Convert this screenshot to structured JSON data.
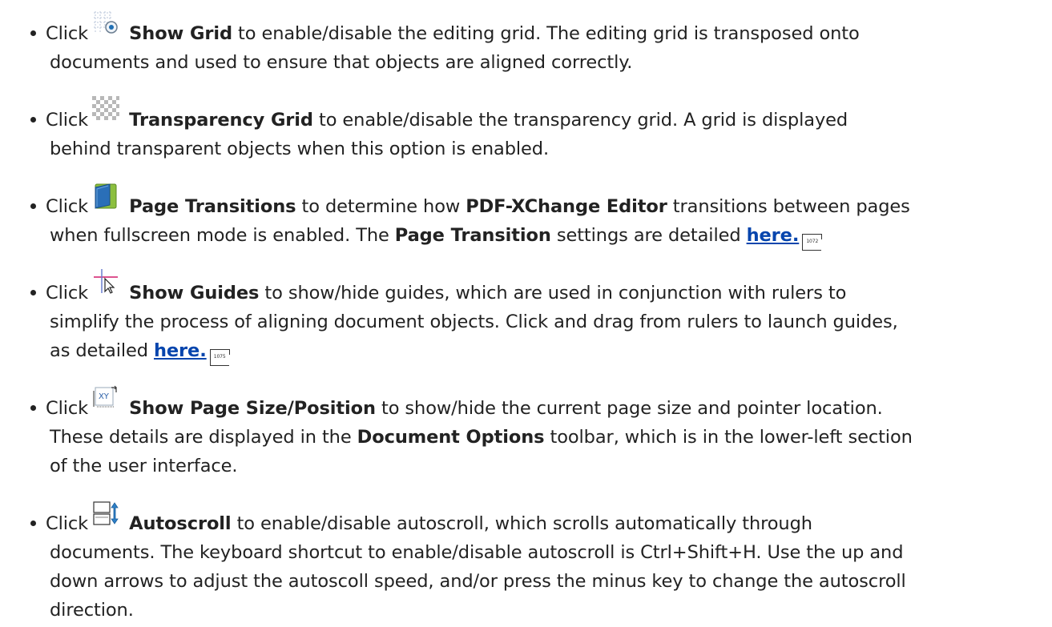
{
  "items": [
    {
      "lines": [
        [
          "Click ",
          "",
          " to enable/disable the editing grid. The editing grid is transposed onto"
        ],
        "documents and used to ensure that objects are aligned correctly."
      ],
      "bold": "Show Grid",
      "icon": "show-grid-icon"
    },
    {
      "lines": [
        [
          "Click ",
          "",
          " to enable/disable the transparency grid. A grid is displayed"
        ],
        "behind transparent objects when this option is enabled."
      ],
      "bold": "Transparency Grid",
      "icon": "transparency-grid-icon"
    },
    {
      "bold": "Page Transitions",
      "icon": "page-transitions-icon",
      "l1_pre": "Click ",
      "l1_mid": " to determine how ",
      "l1_bold2": "PDF-XChange Editor",
      "l1_post": " transitions between pages",
      "l2_pre": "when fullscreen mode is enabled. The ",
      "l2_bold": "Page Transition",
      "l2_mid": " settings are detailed ",
      "link": "here.",
      "pageref": "1072"
    },
    {
      "bold": "Show Guides",
      "icon": "show-guides-icon",
      "l1_pre": "Click ",
      "l1_post": " to show/hide guides, which are used in conjunction with rulers to",
      "l2": "simplify the process of aligning document objects. Click and drag from rulers to launch guides,",
      "l3_pre": "as detailed ",
      "link": "here.",
      "pageref": "1075"
    },
    {
      "bold": "Show Page Size/Position",
      "icon": "page-size-position-icon",
      "l1_pre": "Click ",
      "l1_post": " to show/hide the current page size and pointer location.",
      "l2_pre": "These details are displayed in the ",
      "l2_bold": "Document Options",
      "l2_post": " toolbar, which is in the lower-left section",
      "l3": "of the user interface."
    },
    {
      "bold": "Autoscroll",
      "icon": "autoscroll-icon",
      "l1_pre": "Click ",
      "l1_post": " to enable/disable autoscroll, which scrolls automatically through",
      "l2": "documents. The keyboard shortcut to enable/disable autoscroll is Ctrl+Shift+H. Use the up and",
      "l3": "down arrows to adjust the autoscoll speed, and/or press the minus key to change the autoscroll",
      "l4": "direction."
    }
  ]
}
